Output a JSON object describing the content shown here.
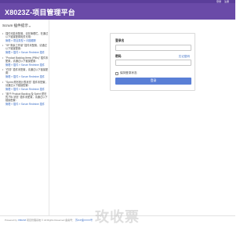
{
  "topbar": {
    "login_label": "登录",
    "register_label": "注册"
  },
  "header": {
    "title": "X8023Z-项目管理平台"
  },
  "sidebar": {
    "title": "Scrum 插件提示",
    "items": [
      {
        "text": "插件可能未配置，请在管理栏，在通过以下链接配置相关可用：",
        "link": "管理 » 项目类型 » 问题跟踪"
      },
      {
        "text": "\"SP 剩余工作量\" 插件未配置，请通过以下链接配置：",
        "link": "管理 » 插件 » Scrum Redmine 插件"
      },
      {
        "text": "\"Product Backlog Items (PBIs)\" 插件未配置，请通过以下链接配置：",
        "link": "管理 » 插件 » Scrum Redmine 插件"
      },
      {
        "text": "\"任务\" 插件未配置，请通过以下链接配置：",
        "link": "管理 » 插件 » Scrum Redmine 插件"
      },
      {
        "text": "\"Sprint 燃尽统计表状态\" 插件未配置，请通过以下链接配置：",
        "link": "管理 » 插件 » Scrum Redmine 插件"
      },
      {
        "text": "\"用于 Product Backlog 及 Sprint 燃尽的 PBI 状态\" 插件未配置，请通过以下链接配置：",
        "link": "管理 » 插件 » Scrum Redmine 插件"
      }
    ]
  },
  "login": {
    "username_label": "登录名",
    "username_value": "",
    "password_label": "密码",
    "password_value": "",
    "forgot_label": "忘记密码",
    "remember_label": "保持登录状态",
    "submit_label": "登录"
  },
  "footer": {
    "prefix": "Powered by",
    "link": "X8023Z",
    "rest": "项目管理系统 © All Rights Reserved  备案号：",
    "icp": "苏ICP备XXXX号"
  },
  "watermark": "玫收票",
  "colors": {
    "header_bg": "#6a4aa8",
    "topbar_bg": "#5b3e9a",
    "link": "#3a6dc5",
    "button_bg": "#5a7fd6"
  }
}
